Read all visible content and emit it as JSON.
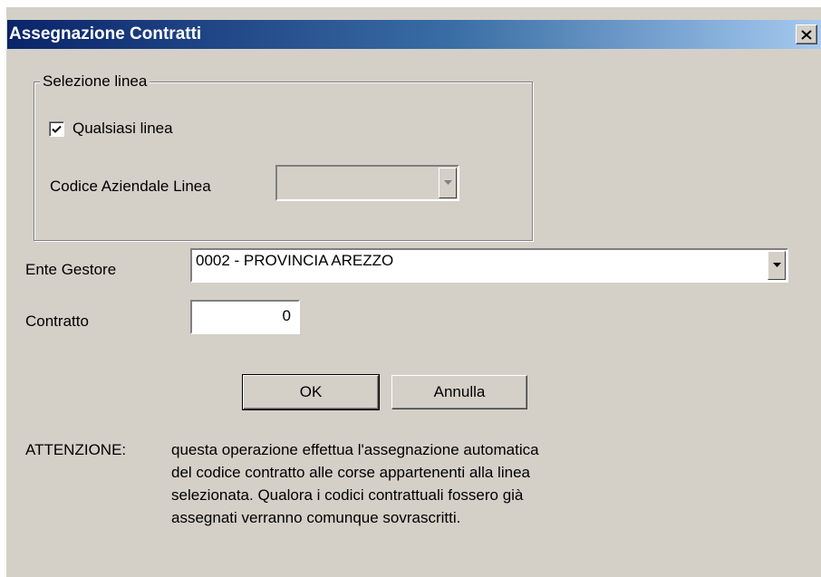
{
  "window": {
    "title": "Assegnazione Contratti"
  },
  "group": {
    "title": "Selezione linea",
    "any_line_label": "Qualsiasi linea",
    "any_line_checked": true,
    "line_code_label": "Codice Aziendale Linea",
    "line_code_value": ""
  },
  "form": {
    "ente_label": "Ente Gestore",
    "ente_value": "0002 - PROVINCIA AREZZO",
    "contract_label": "Contratto",
    "contract_value": "0"
  },
  "buttons": {
    "ok": "OK",
    "cancel": "Annulla"
  },
  "warning": {
    "prefix": "ATTENZIONE:",
    "lines": [
      "questa operazione effettua l'assegnazione automatica",
      "del codice contratto alle corse appartenenti alla linea",
      "selezionata. Qualora i codici contrattuali fossero già",
      "assegnati verranno comunque sovrascritti."
    ]
  },
  "icons": {
    "close": "close-icon",
    "check": "checkmark-icon",
    "dropdown": "chevron-down-icon"
  }
}
